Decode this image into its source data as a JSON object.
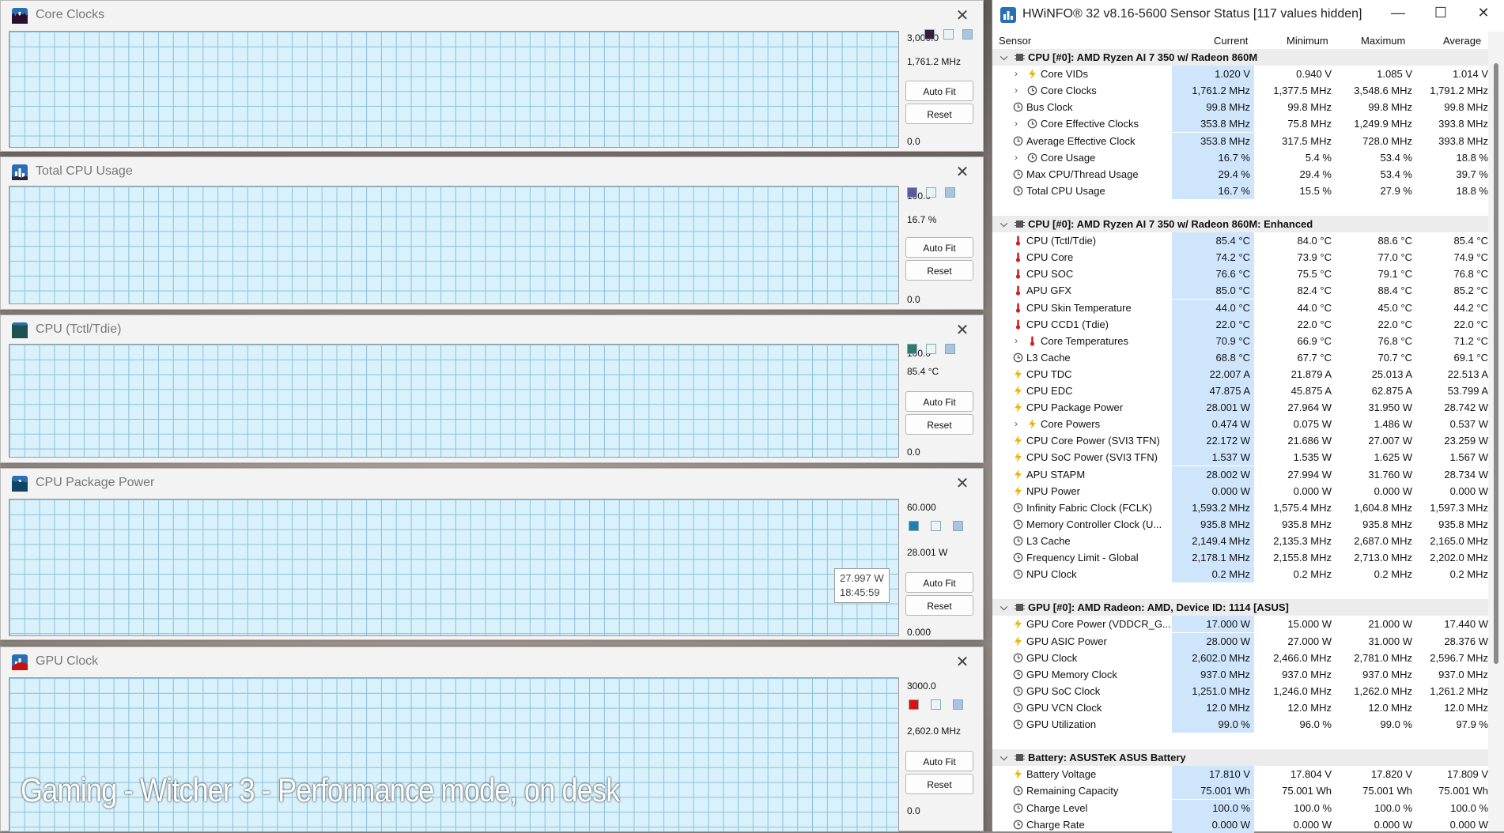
{
  "graphs": [
    {
      "id": "core-clocks",
      "title": "Core Clocks",
      "top": "3,000.0",
      "current": "1,761.2 MHz",
      "bottom": "0.0",
      "color": "#2b0f2e",
      "swatch": "#3a1a3e"
    },
    {
      "id": "total-cpu-usage",
      "title": "Total CPU Usage",
      "top": "100.0",
      "current": "16.7 %",
      "bottom": "0.0",
      "color": "#2a2340",
      "swatch": "#5b5aa0"
    },
    {
      "id": "cpu-tctl",
      "title": "CPU (Tctl/Tdie)",
      "top": "100.0",
      "current": "85.4 °C",
      "bottom": "0.0",
      "color": "#1b524f",
      "swatch": "#2c7a72"
    },
    {
      "id": "cpu-package-power",
      "title": "CPU Package Power",
      "top": "60.000",
      "current": "28.001 W",
      "bottom": "0.000",
      "color": "#0d4664",
      "swatch": "#1f80b8"
    },
    {
      "id": "gpu-clock",
      "title": "GPU Clock",
      "top": "3000.0",
      "current": "2,602.0 MHz",
      "bottom": "0.0",
      "color": "#cc0d0d",
      "swatch": "#dd1111"
    }
  ],
  "buttons": {
    "autofit": "Auto Fit",
    "reset": "Reset"
  },
  "tooltip": {
    "value": "27.997 W",
    "time": "18:45:59"
  },
  "overlay_text": "Gaming - Witcher 3 - Performance mode, on desk",
  "hwinfo": {
    "title": "HWiNFO® 32 v8.16-5600 Sensor Status [117 values hidden]",
    "columns": {
      "sensor": "Sensor",
      "current": "Current",
      "minimum": "Minimum",
      "maximum": "Maximum",
      "average": "Average"
    },
    "rows": [
      {
        "t": "g",
        "name": "CPU [#0]: AMD Ryzen AI 7 350 w/ Radeon 860M"
      },
      {
        "t": "r",
        "icon": "bolt",
        "exp": true,
        "name": "Core VIDs",
        "cur": "1.020 V",
        "min": "0.940 V",
        "max": "1.085 V",
        "avg": "1.014 V"
      },
      {
        "t": "r",
        "icon": "clock",
        "exp": true,
        "name": "Core Clocks",
        "cur": "1,761.2 MHz",
        "min": "1,377.5 MHz",
        "max": "3,548.6 MHz",
        "avg": "1,791.2 MHz"
      },
      {
        "t": "r",
        "icon": "clock",
        "name": "Bus Clock",
        "cur": "99.8 MHz",
        "min": "99.8 MHz",
        "max": "99.8 MHz",
        "avg": "99.8 MHz"
      },
      {
        "t": "r",
        "icon": "clock",
        "exp": true,
        "name": "Core Effective Clocks",
        "cur": "353.8 MHz",
        "min": "75.8 MHz",
        "max": "1,249.9 MHz",
        "avg": "393.8 MHz"
      },
      {
        "t": "r",
        "icon": "clock",
        "name": "Average Effective Clock",
        "cur": "353.8 MHz",
        "min": "317.5 MHz",
        "max": "728.0 MHz",
        "avg": "393.8 MHz"
      },
      {
        "t": "r",
        "icon": "clock",
        "exp": true,
        "name": "Core Usage",
        "cur": "16.7 %",
        "min": "5.4 %",
        "max": "53.4 %",
        "avg": "18.8 %"
      },
      {
        "t": "r",
        "icon": "clock",
        "name": "Max CPU/Thread Usage",
        "cur": "29.4 %",
        "min": "29.4 %",
        "max": "53.4 %",
        "avg": "39.7 %"
      },
      {
        "t": "r",
        "icon": "clock",
        "name": "Total CPU Usage",
        "cur": "16.7 %",
        "min": "15.5 %",
        "max": "27.9 %",
        "avg": "18.8 %"
      },
      {
        "t": "s"
      },
      {
        "t": "g",
        "name": "CPU [#0]: AMD Ryzen AI 7 350 w/ Radeon 860M: Enhanced"
      },
      {
        "t": "r",
        "icon": "temp",
        "name": "CPU (Tctl/Tdie)",
        "cur": "85.4 °C",
        "min": "84.0 °C",
        "max": "88.6 °C",
        "avg": "85.4 °C"
      },
      {
        "t": "r",
        "icon": "temp",
        "name": "CPU Core",
        "cur": "74.2 °C",
        "min": "73.9 °C",
        "max": "77.0 °C",
        "avg": "74.9 °C"
      },
      {
        "t": "r",
        "icon": "temp",
        "name": "CPU SOC",
        "cur": "76.6 °C",
        "min": "75.5 °C",
        "max": "79.1 °C",
        "avg": "76.8 °C"
      },
      {
        "t": "r",
        "icon": "temp",
        "name": "APU GFX",
        "cur": "85.0 °C",
        "min": "82.4 °C",
        "max": "88.4 °C",
        "avg": "85.2 °C"
      },
      {
        "t": "r",
        "icon": "temp",
        "name": "CPU Skin Temperature",
        "cur": "44.0 °C",
        "min": "44.0 °C",
        "max": "45.0 °C",
        "avg": "44.2 °C"
      },
      {
        "t": "r",
        "icon": "temp",
        "name": "CPU CCD1 (Tdie)",
        "cur": "22.0 °C",
        "min": "22.0 °C",
        "max": "22.0 °C",
        "avg": "22.0 °C"
      },
      {
        "t": "r",
        "icon": "temp",
        "exp": true,
        "name": "Core Temperatures",
        "cur": "70.9 °C",
        "min": "66.9 °C",
        "max": "76.8 °C",
        "avg": "71.2 °C"
      },
      {
        "t": "r",
        "icon": "clock",
        "name": "L3 Cache",
        "cur": "68.8 °C",
        "min": "67.7 °C",
        "max": "70.7 °C",
        "avg": "69.1 °C"
      },
      {
        "t": "r",
        "icon": "bolt",
        "name": "CPU TDC",
        "cur": "22.007 A",
        "min": "21.879 A",
        "max": "25.013 A",
        "avg": "22.513 A"
      },
      {
        "t": "r",
        "icon": "bolt",
        "name": "CPU EDC",
        "cur": "47.875 A",
        "min": "45.875 A",
        "max": "62.875 A",
        "avg": "53.799 A"
      },
      {
        "t": "r",
        "icon": "bolt",
        "name": "CPU Package Power",
        "cur": "28.001 W",
        "min": "27.964 W",
        "max": "31.950 W",
        "avg": "28.742 W"
      },
      {
        "t": "r",
        "icon": "bolt",
        "exp": true,
        "name": "Core Powers",
        "cur": "0.474 W",
        "min": "0.075 W",
        "max": "1.486 W",
        "avg": "0.537 W"
      },
      {
        "t": "r",
        "icon": "bolt",
        "name": "CPU Core Power (SVI3 TFN)",
        "cur": "22.172 W",
        "min": "21.686 W",
        "max": "27.007 W",
        "avg": "23.259 W"
      },
      {
        "t": "r",
        "icon": "bolt",
        "name": "CPU SoC Power (SVI3 TFN)",
        "cur": "1.537 W",
        "min": "1.535 W",
        "max": "1.625 W",
        "avg": "1.567 W"
      },
      {
        "t": "r",
        "icon": "bolt",
        "name": "APU STAPM",
        "cur": "28.002 W",
        "min": "27.994 W",
        "max": "31.760 W",
        "avg": "28.734 W"
      },
      {
        "t": "r",
        "icon": "bolt",
        "name": "NPU Power",
        "cur": "0.000 W",
        "min": "0.000 W",
        "max": "0.000 W",
        "avg": "0.000 W"
      },
      {
        "t": "r",
        "icon": "clock",
        "name": "Infinity Fabric Clock (FCLK)",
        "cur": "1,593.2 MHz",
        "min": "1,575.4 MHz",
        "max": "1,604.8 MHz",
        "avg": "1,597.3 MHz"
      },
      {
        "t": "r",
        "icon": "clock",
        "name": "Memory Controller Clock (U...",
        "cur": "935.8 MHz",
        "min": "935.8 MHz",
        "max": "935.8 MHz",
        "avg": "935.8 MHz"
      },
      {
        "t": "r",
        "icon": "clock",
        "name": "L3 Cache",
        "cur": "2,149.4 MHz",
        "min": "2,135.3 MHz",
        "max": "2,687.0 MHz",
        "avg": "2,165.0 MHz"
      },
      {
        "t": "r",
        "icon": "clock",
        "name": "Frequency Limit - Global",
        "cur": "2,178.1 MHz",
        "min": "2,155.8 MHz",
        "max": "2,713.0 MHz",
        "avg": "2,202.0 MHz"
      },
      {
        "t": "r",
        "icon": "clock",
        "name": "NPU Clock",
        "cur": "0.2 MHz",
        "min": "0.2 MHz",
        "max": "0.2 MHz",
        "avg": "0.2 MHz"
      },
      {
        "t": "s"
      },
      {
        "t": "g",
        "name": "GPU [#0]: AMD Radeon: AMD, Device ID: 1114 [ASUS]"
      },
      {
        "t": "r",
        "icon": "bolt",
        "name": "GPU Core Power (VDDCR_G...",
        "cur": "17.000 W",
        "min": "15.000 W",
        "max": "21.000 W",
        "avg": "17.440 W"
      },
      {
        "t": "r",
        "icon": "bolt",
        "name": "GPU ASIC Power",
        "cur": "28.000 W",
        "min": "27.000 W",
        "max": "31.000 W",
        "avg": "28.376 W"
      },
      {
        "t": "r",
        "icon": "clock",
        "name": "GPU Clock",
        "cur": "2,602.0 MHz",
        "min": "2,466.0 MHz",
        "max": "2,781.0 MHz",
        "avg": "2,596.7 MHz"
      },
      {
        "t": "r",
        "icon": "clock",
        "name": "GPU Memory Clock",
        "cur": "937.0 MHz",
        "min": "937.0 MHz",
        "max": "937.0 MHz",
        "avg": "937.0 MHz"
      },
      {
        "t": "r",
        "icon": "clock",
        "name": "GPU SoC Clock",
        "cur": "1,251.0 MHz",
        "min": "1,246.0 MHz",
        "max": "1,262.0 MHz",
        "avg": "1,261.2 MHz"
      },
      {
        "t": "r",
        "icon": "clock",
        "name": "GPU VCN Clock",
        "cur": "12.0 MHz",
        "min": "12.0 MHz",
        "max": "12.0 MHz",
        "avg": "12.0 MHz"
      },
      {
        "t": "r",
        "icon": "clock",
        "name": "GPU Utilization",
        "cur": "99.0 %",
        "min": "96.0 %",
        "max": "99.0 %",
        "avg": "97.9 %"
      },
      {
        "t": "s"
      },
      {
        "t": "g",
        "name": "Battery: ASUSTeK ASUS Battery"
      },
      {
        "t": "r",
        "icon": "bolt",
        "name": "Battery Voltage",
        "cur": "17.810 V",
        "min": "17.804 V",
        "max": "17.820 V",
        "avg": "17.809 V"
      },
      {
        "t": "r",
        "icon": "clock",
        "name": "Remaining Capacity",
        "cur": "75.001 Wh",
        "min": "75.001 Wh",
        "max": "75.001 Wh",
        "avg": "75.001 Wh"
      },
      {
        "t": "r",
        "icon": "clock",
        "name": "Charge Level",
        "cur": "100.0 %",
        "min": "100.0 %",
        "max": "100.0 %",
        "avg": "100.0 %"
      },
      {
        "t": "r",
        "icon": "clock",
        "name": "Charge Rate",
        "cur": "0.000 W",
        "min": "0.000 W",
        "max": "0.000 W",
        "avg": "0.000 W"
      }
    ]
  }
}
